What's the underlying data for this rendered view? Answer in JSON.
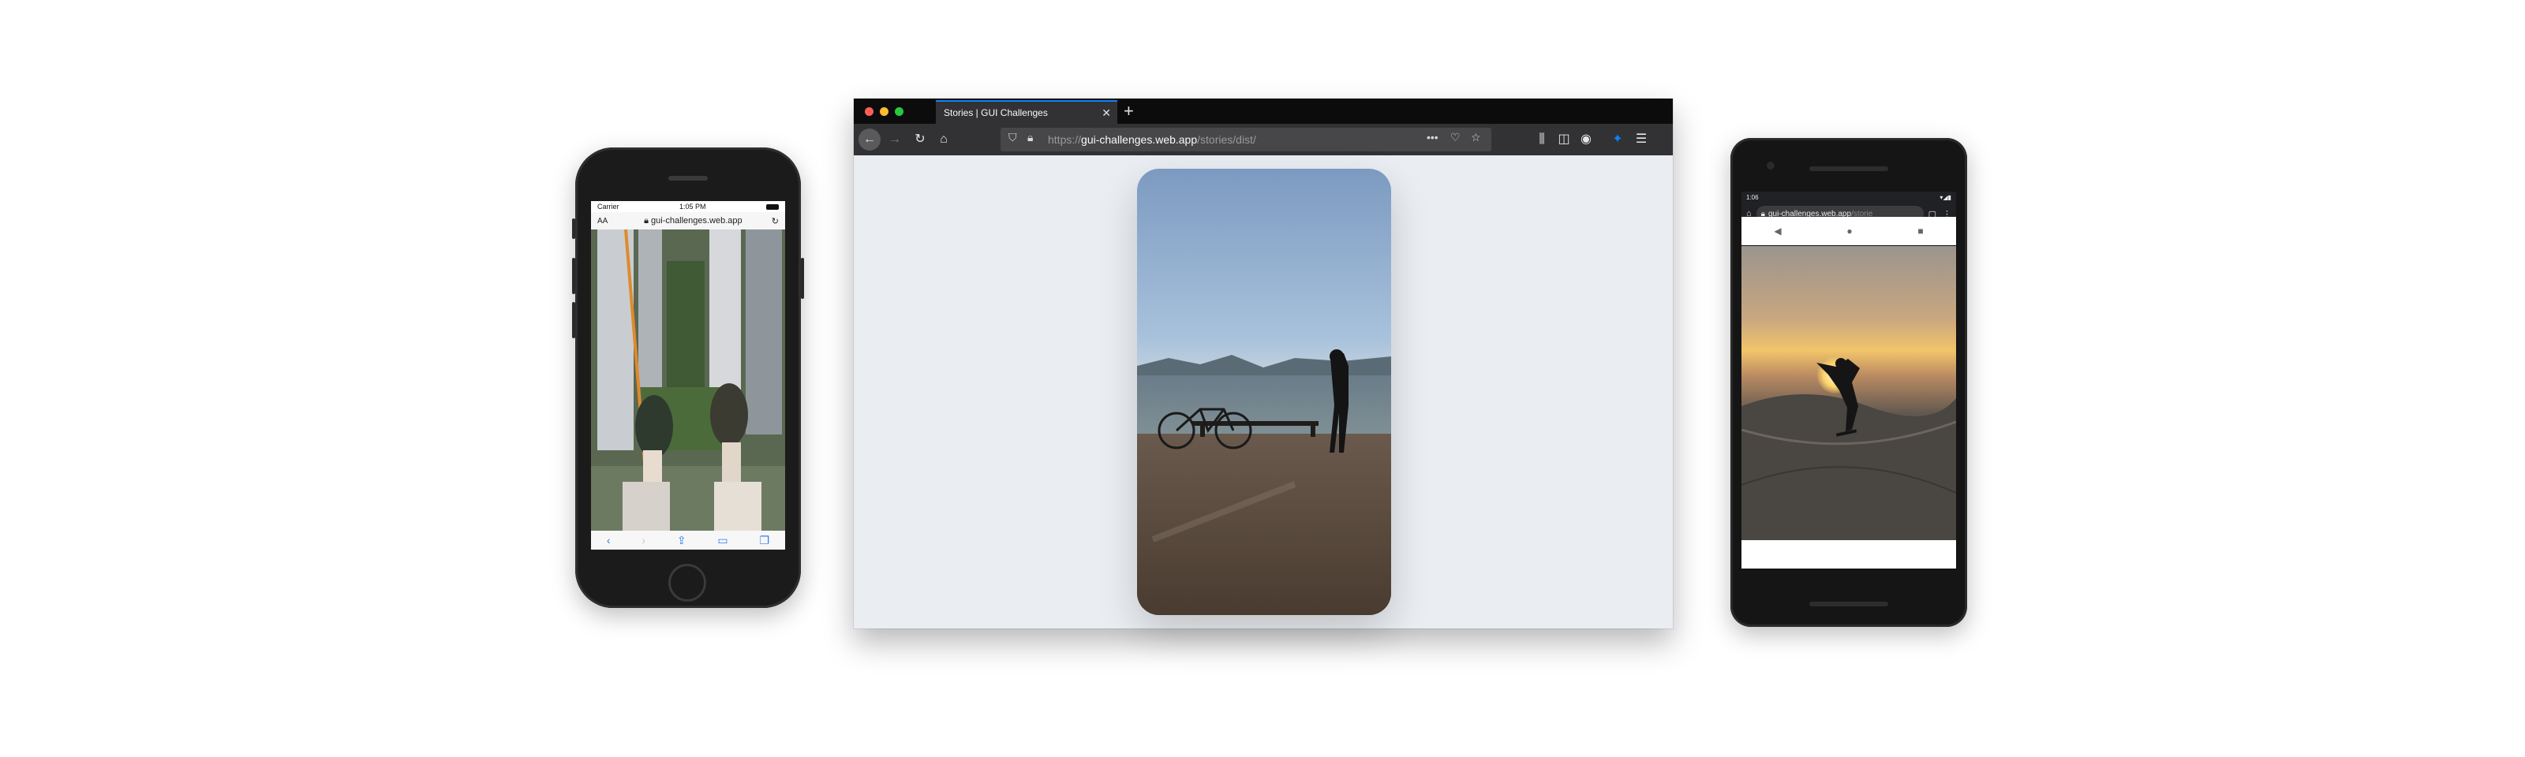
{
  "iphone": {
    "status": {
      "carrier": "Carrier",
      "time": "1:05 PM"
    },
    "urlbar": {
      "text_size": "AA",
      "host": "gui-challenges.web.app"
    },
    "toolbar": {
      "back": "‹",
      "forward": "›",
      "share": "⇪",
      "bookmarks": "▭",
      "tabs": "❐"
    }
  },
  "browser": {
    "tab": {
      "title": "Stories | GUI Challenges"
    },
    "url": {
      "scheme": "https://",
      "host": "gui-challenges.web.app",
      "path": "/stories/dist/"
    }
  },
  "android": {
    "status": {
      "time": "1:06"
    },
    "omnibox": {
      "host": "gui-challenges.web.app",
      "path": "/storie"
    },
    "navbar": {
      "back": "◀",
      "home": "●",
      "recents": "■"
    }
  },
  "colors": {
    "firefox_accent": "#0a84ff",
    "traffic_close": "#ff5f57",
    "traffic_min": "#febc2e",
    "traffic_max": "#28c840",
    "ios_blue": "#2f7bf5"
  }
}
